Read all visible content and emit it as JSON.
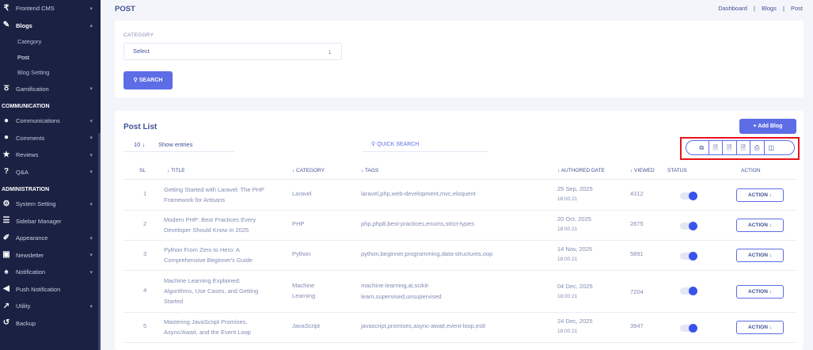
{
  "sidebar": {
    "items": [
      {
        "icon": "frontend-icon",
        "label": "Frontend CMS"
      },
      {
        "icon": "blog-icon",
        "label": "Blogs"
      },
      {
        "label": "Category"
      },
      {
        "label": "Post"
      },
      {
        "label": "Blog Setting"
      },
      {
        "icon": "gamification-icon",
        "label": "Gamification"
      },
      {
        "label": "COMMUNICATION"
      },
      {
        "icon": "communications-icon",
        "label": "Communications"
      },
      {
        "icon": "comments-icon",
        "label": "Comments"
      },
      {
        "icon": "star-icon",
        "label": "Reviews"
      },
      {
        "icon": "question-icon",
        "label": "Q&A"
      },
      {
        "label": "ADMINISTRATION"
      },
      {
        "icon": "gears-icon",
        "label": "System Setting"
      },
      {
        "icon": "menu-icon",
        "label": "Sidebar Manager"
      },
      {
        "icon": "brush-icon",
        "label": "Appearance"
      },
      {
        "icon": "newsletter-icon",
        "label": "Newsletter"
      },
      {
        "icon": "bell-icon",
        "label": "Notification"
      },
      {
        "icon": "megaphone-icon",
        "label": "Push Notification"
      },
      {
        "icon": "wrench-icon",
        "label": "Utility"
      },
      {
        "icon": "backup-icon",
        "label": "Backup"
      }
    ]
  },
  "header": {
    "title": "POST",
    "breadcrumb": [
      "Dashboard",
      "|",
      "Blogs",
      "|",
      "Post"
    ]
  },
  "filter": {
    "category_label": "CATEGORY",
    "category_value": "Select",
    "search_label": "SEARCH"
  },
  "list": {
    "title": "Post List",
    "add_label": "+ Add Blog",
    "entries_value": "10",
    "entries_label": "Show entries",
    "quick_search_placeholder": "QUICK SEARCH",
    "export_buttons": [
      "copy-icon",
      "csv-icon",
      "excel-icon",
      "pdf-icon",
      "print-icon",
      "columns-icon"
    ],
    "columns": [
      "SL",
      "↓ TITLE",
      "↓ CATEGORY",
      "↓ TAGS",
      "↓ AUTHORED DATE",
      "↓ VIEWED",
      "STATUS",
      "ACTION"
    ],
    "rows": [
      {
        "sl": "1",
        "title": "Getting Started with Laravel: The PHP Framework for Artisans",
        "category": "Laravel",
        "tags": "laravel,php,web-development,mvc,eloquent",
        "date": "25 Sep, 2025",
        "time": "18:00:21",
        "viewed": "4312",
        "status": true,
        "action": "ACTION ↓"
      },
      {
        "sl": "2",
        "title": "Modern PHP: Best Practices Every Developer Should Know in 2025",
        "category": "PHP",
        "tags": "php,php8,best-practices,enums,strict-types",
        "date": "20 Oct, 2025",
        "time": "18:00:21",
        "viewed": "2875",
        "status": true,
        "action": "ACTION ↓"
      },
      {
        "sl": "3",
        "title": "Python From Zero to Hero: A Comprehensive Beginner's Guide",
        "category": "Python",
        "tags": "python,beginner,programming,data-structures,oop",
        "date": "14 Nov, 2025",
        "time": "18:00:21",
        "viewed": "5891",
        "status": true,
        "action": "ACTION ↓"
      },
      {
        "sl": "4",
        "title": "Machine Learning Explained: Algorithms, Use Cases, and Getting Started",
        "category": "Machine Learning",
        "tags": "machine-learning,ai,scikit-learn,supervised,unsupervised",
        "date": "04 Dec, 2025",
        "time": "18:00:21",
        "viewed": "7204",
        "status": true,
        "action": "ACTION ↓"
      },
      {
        "sl": "5",
        "title": "Mastering JavaScript Promises, Async/Await, and the Event Loop",
        "category": "JavaScript",
        "tags": "javascript,promises,async-await,event-loop,es6",
        "date": "24 Dec, 2025",
        "time": "18:00:21",
        "viewed": "3947",
        "status": true,
        "action": "ACTION ↓"
      }
    ]
  },
  "colors": {
    "sidebar_bg": "#1b2143",
    "accent": "#5d6de6",
    "text": "#415094",
    "highlight": "#e8141b"
  }
}
